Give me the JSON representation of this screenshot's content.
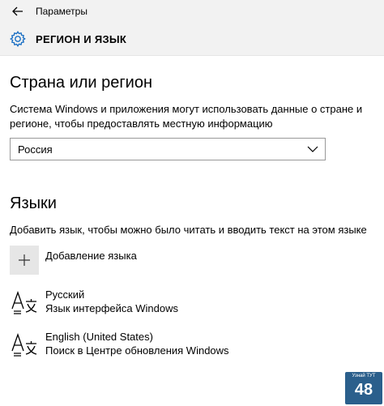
{
  "window": {
    "title": "Параметры"
  },
  "header": {
    "title": "РЕГИОН И ЯЗЫК"
  },
  "country": {
    "heading": "Страна или регион",
    "description": "Система Windows и приложения могут использовать данные о стране и регионе, чтобы предоставлять местную информацию",
    "selected": "Россия"
  },
  "languages": {
    "heading": "Языки",
    "description": "Добавить язык, чтобы можно было читать и вводить текст на этом языке",
    "add_label": "Добавление языка",
    "items": [
      {
        "name": "Русский",
        "status": "Язык интерфейса Windows"
      },
      {
        "name": "English (United States)",
        "status": "Поиск в Центре обновления Windows"
      }
    ]
  },
  "watermark": {
    "top": "Узнай ТУТ",
    "num": "48"
  }
}
